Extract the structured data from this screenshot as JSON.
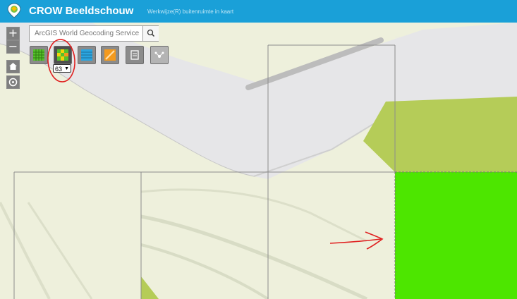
{
  "header": {
    "title": "CROW Beeldschouw",
    "subtitle": "Werkwijze(R) buitenruimte in kaart",
    "background": "#1aa0d8"
  },
  "map_controls": {
    "zoom_in": "+",
    "zoom_out": "−",
    "home_icon": "home-icon",
    "locate_icon": "locate-icon"
  },
  "search": {
    "placeholder": "ArcGIS World Geocoding Service",
    "button_icon": "search-icon"
  },
  "toolbar": {
    "tools": [
      {
        "icon": "grid-layer-icon",
        "color": "#56c12b"
      },
      {
        "icon": "heatmap-grid-icon",
        "color": "#f4d20b"
      },
      {
        "icon": "list-layer-icon",
        "color": "#2aa5e0"
      },
      {
        "icon": "measure-icon",
        "color": "#f49a1d"
      },
      {
        "icon": "notes-icon",
        "color": "#ffffff"
      },
      {
        "icon": "share-icon",
        "color": "#ffffff"
      }
    ],
    "selected_value": "63"
  },
  "map": {
    "highlight_color": "#4de600",
    "green_area_color": "#b5cc58",
    "road_color": "#e6e6e8"
  }
}
